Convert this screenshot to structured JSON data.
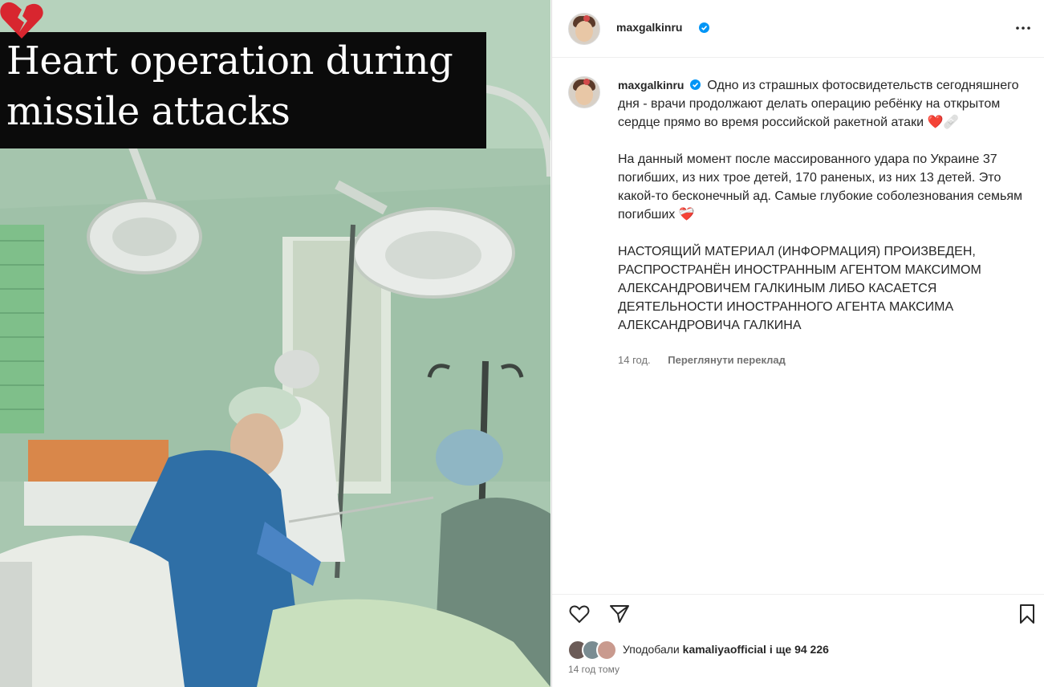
{
  "photo": {
    "caption_line1": "Heart operation during",
    "caption_line2": "missile attacks"
  },
  "header": {
    "username": "maxgalkinru"
  },
  "comment": {
    "username": "maxgalkinru",
    "paragraph1": "Одно из страшных фотосвидетельств сегодняшнего дня - врачи продолжают делать операцию ребёнку на открытом сердце прямо во время российской ракетной атаки ❤️🩹",
    "paragraph2": "На данный момент после массированного удара по Украине 37 погибших, из них трое детей, 170 раненых, из них 13 детей. Это какой-то бесконечный ад. Самые глубокие соболезнования семьям погибших ❤️‍🩹",
    "paragraph3": "НАСТОЯЩИЙ МАТЕРИАЛ (ИНФОРМАЦИЯ) ПРОИЗВЕДЕН, РАСПРОСТРАНЁН ИНОСТРАННЫМ АГЕНТОМ МАКСИМОМ АЛЕКСАНДРОВИЧЕМ ГАЛКИНЫМ ЛИБО КАСАЕТСЯ ДЕЯТЕЛЬНОСТИ ИНОСТРАННОГО АГЕНТА МАКСИМА АЛЕКСАНДРОВИЧА ГАЛКИНА",
    "age": "14 год.",
    "translate_label": "Переглянути переклад"
  },
  "likes": {
    "prefix": "Уподобали ",
    "user": "kamaliyaofficial",
    "suffix": " і ще 94 226"
  },
  "post_time": "14 год тому",
  "colors": {
    "verified": "#0095f6",
    "text": "#262626",
    "muted": "#737373"
  }
}
